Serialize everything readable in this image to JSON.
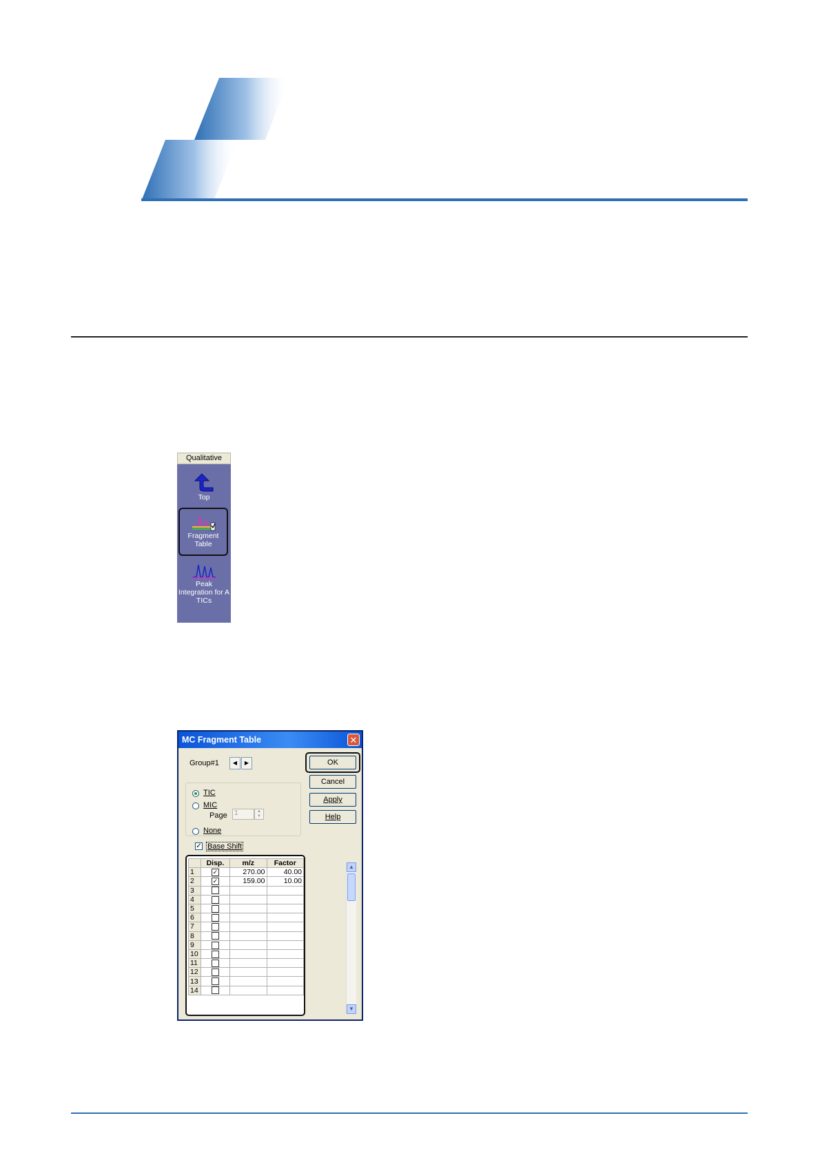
{
  "qualitative_panel": {
    "header": "Qualitative",
    "items": [
      {
        "label_line1": "Top",
        "label_line2": "",
        "label_line3": ""
      },
      {
        "label_line1": "Fragment",
        "label_line2": "Table",
        "label_line3": ""
      },
      {
        "label_line1": "Peak",
        "label_line2": "Integration for A",
        "label_line3": "TICs"
      }
    ]
  },
  "dialog": {
    "title": "MC Fragment Table",
    "close_glyph": "✕",
    "group_label": "Group#1",
    "prev_glyph": "◀",
    "next_glyph": "▶",
    "buttons": {
      "ok": "OK",
      "cancel": "Cancel",
      "apply": "Apply",
      "help": "Help"
    },
    "radios": {
      "tic": "TIC",
      "mic": "MIC",
      "none": "None",
      "selected": "TIC"
    },
    "page_label": "Page",
    "page_value": "1",
    "base_shift_label": "Base Shift",
    "base_shift_checked": true,
    "table": {
      "columns": [
        "",
        "Disp.",
        "m/z",
        "Factor"
      ],
      "rows": [
        {
          "idx": "1",
          "disp": true,
          "mz": "270.00",
          "factor": "40.00"
        },
        {
          "idx": "2",
          "disp": true,
          "mz": "159.00",
          "factor": "10.00"
        },
        {
          "idx": "3",
          "disp": false,
          "mz": "",
          "factor": ""
        },
        {
          "idx": "4",
          "disp": false,
          "mz": "",
          "factor": ""
        },
        {
          "idx": "5",
          "disp": false,
          "mz": "",
          "factor": ""
        },
        {
          "idx": "6",
          "disp": false,
          "mz": "",
          "factor": ""
        },
        {
          "idx": "7",
          "disp": false,
          "mz": "",
          "factor": ""
        },
        {
          "idx": "8",
          "disp": false,
          "mz": "",
          "factor": ""
        },
        {
          "idx": "9",
          "disp": false,
          "mz": "",
          "factor": ""
        },
        {
          "idx": "10",
          "disp": false,
          "mz": "",
          "factor": ""
        },
        {
          "idx": "11",
          "disp": false,
          "mz": "",
          "factor": ""
        },
        {
          "idx": "12",
          "disp": false,
          "mz": "",
          "factor": ""
        },
        {
          "idx": "13",
          "disp": false,
          "mz": "",
          "factor": ""
        },
        {
          "idx": "14",
          "disp": false,
          "mz": "",
          "factor": ""
        }
      ]
    }
  },
  "colors": {
    "accent": "#2e6fb5",
    "panel": "#6b6fa8",
    "title_bar": "#0a54d8"
  }
}
